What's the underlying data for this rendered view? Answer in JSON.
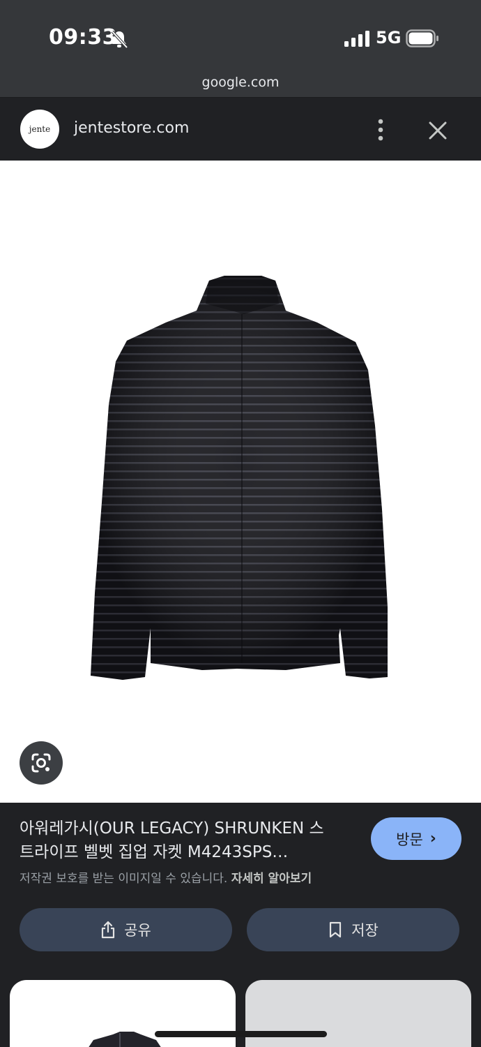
{
  "status_bar": {
    "time": "09:33",
    "network": "5G",
    "icons": [
      "bell-off-icon",
      "signal-icon",
      "battery-icon"
    ]
  },
  "browser": {
    "url": "google.com",
    "site_name": "jentestore.com",
    "favicon_text": "jente",
    "icons": [
      "kebab-menu-icon",
      "close-icon"
    ]
  },
  "viewer": {
    "lens_icon": "google-lens-icon"
  },
  "result": {
    "title_line1": "아워레가시(OUR LEGACY) SHRUNKEN 스",
    "title_line2": "트라이프 벨벳 집업 자켓 M4243SPS…",
    "visit_label": "방문",
    "copyright_text": "저작권 보호를 받는 이미지일 수 있습니다.",
    "learn_more": "자세히 알아보기",
    "share_label": "공유",
    "save_label": "저장"
  },
  "colors": {
    "background": "#202124",
    "accent": "#8ab4f8",
    "button_bg": "#394457"
  }
}
